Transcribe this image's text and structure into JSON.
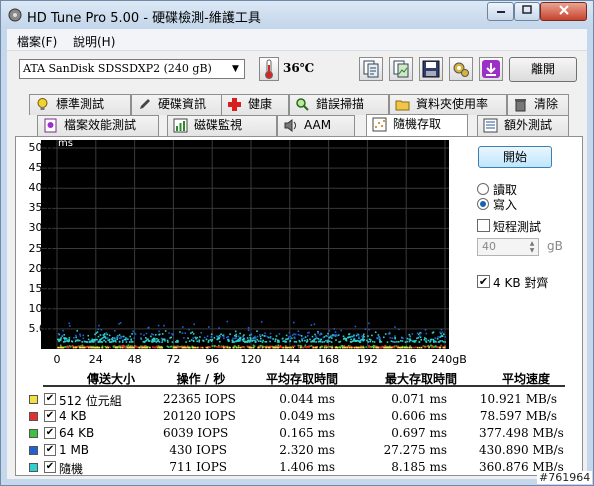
{
  "window": {
    "title": "HD Tune Pro  5.00 - 硬碟檢測-維護工具",
    "controls": [
      "minimize",
      "maximize",
      "close"
    ]
  },
  "menubar": {
    "file": "檔案(F)",
    "help": "說明(H)"
  },
  "toolbar": {
    "drive": "ATA    SanDisk SDSSDXP2 (240 gB)",
    "temperature": "36℃",
    "icons": [
      "copy-text-icon",
      "copy-screenshot-icon",
      "save-icon",
      "options-icon",
      "download-icon"
    ],
    "exit_label": "離開"
  },
  "tabs": {
    "row1": [
      "標準測試",
      "硬碟資訊",
      "健康",
      "錯誤掃描",
      "資料夾使用率",
      "清除"
    ],
    "row2": [
      "檔案效能測試",
      "磁碟監視",
      "AAM",
      "隨機存取",
      "額外測試"
    ],
    "active": "隨機存取"
  },
  "graph": {
    "y_unit": "ms",
    "y_ticks": [
      "50.0",
      "45.0",
      "40.0",
      "35.0",
      "30.0",
      "25.0",
      "20.0",
      "15.0",
      "10.0",
      "5.00"
    ],
    "x_ticks": [
      "0",
      "24",
      "48",
      "72",
      "96",
      "120",
      "144",
      "168",
      "192",
      "216",
      "240gB"
    ]
  },
  "controls": {
    "start_label": "開始",
    "read_label": "讀取",
    "write_label": "寫入",
    "mode_selected": "write",
    "short_test_label": "短程測試",
    "short_test_checked": false,
    "size_value": "40",
    "size_unit": "gB",
    "align_label": "4 KB 對齊",
    "align_checked": true
  },
  "table": {
    "headers": [
      "傳送大小",
      "操作 / 秒",
      "平均存取時間",
      "最大存取時間",
      "平均速度"
    ],
    "rows": [
      {
        "name": "512 位元組",
        "color": "#f0e040",
        "checked": true,
        "ops": "22365 IOPS",
        "avg": "0.044 ms",
        "max": "0.071 ms",
        "speed": "10.921 MB/s"
      },
      {
        "name": "4 KB",
        "color": "#e03030",
        "checked": true,
        "ops": "20120 IOPS",
        "avg": "0.049 ms",
        "max": "0.606 ms",
        "speed": "78.597 MB/s"
      },
      {
        "name": "64 KB",
        "color": "#40c040",
        "checked": true,
        "ops": "6039 IOPS",
        "avg": "0.165 ms",
        "max": "0.697 ms",
        "speed": "377.498 MB/s"
      },
      {
        "name": "1 MB",
        "color": "#2060d0",
        "checked": true,
        "ops": "430 IOPS",
        "avg": "2.320 ms",
        "max": "27.275 ms",
        "speed": "430.890 MB/s"
      },
      {
        "name": "隨機",
        "color": "#30d0d0",
        "checked": true,
        "ops": "711 IOPS",
        "avg": "1.406 ms",
        "max": "8.185 ms",
        "speed": "360.876 MB/s"
      }
    ]
  },
  "watermark": "#761964"
}
